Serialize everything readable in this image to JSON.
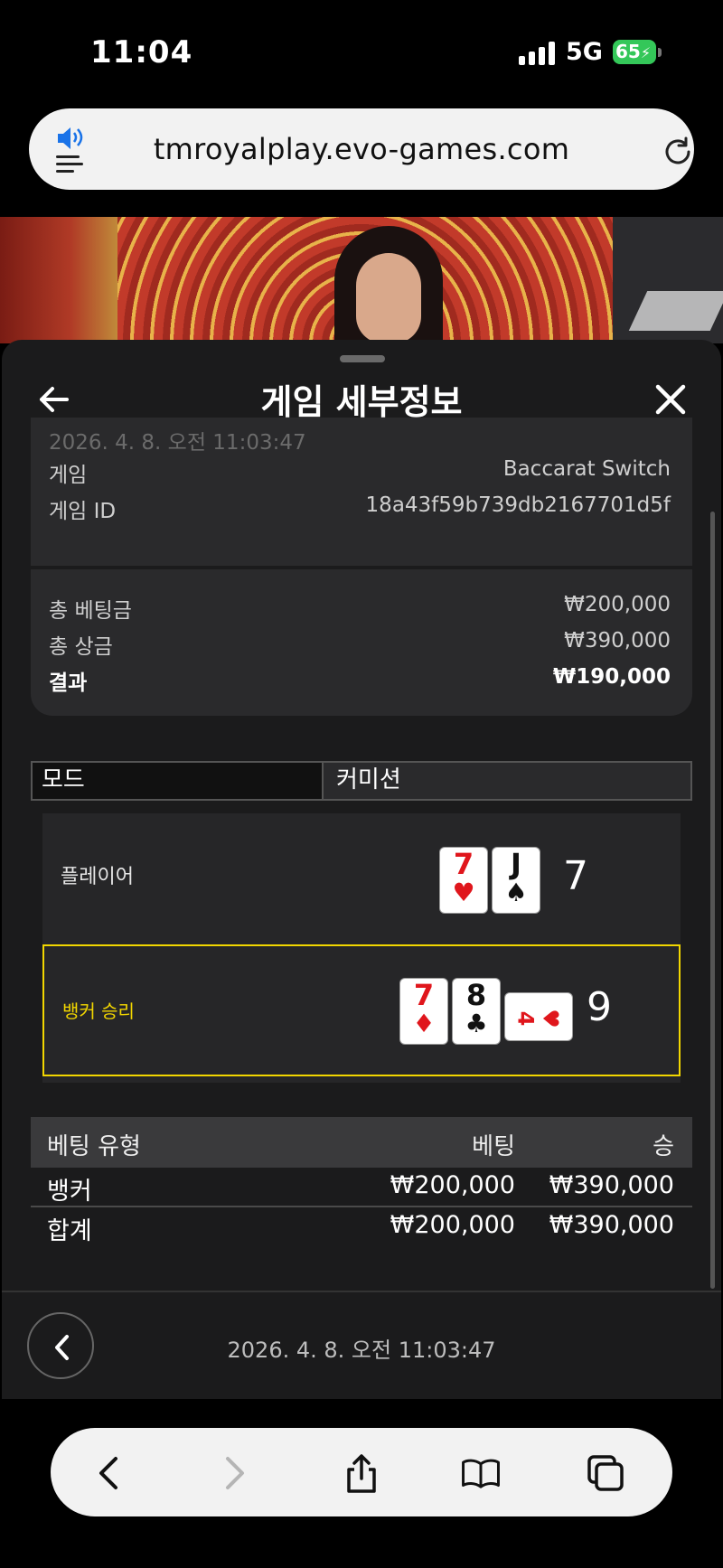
{
  "status": {
    "time": "11:04",
    "network": "5G",
    "battery": "65"
  },
  "browser": {
    "url": "tmroyalplay.evo-games.com"
  },
  "panel": {
    "title": "게임 세부정보",
    "info": {
      "date_faded": "2026. 4. 8. 오전 11:03:47",
      "game_label": "게임",
      "game_value": "Baccarat Switch",
      "game_id_label": "게임 ID",
      "game_id_value": "18a43f59b739db2167701d5f"
    },
    "summary": {
      "total_bet_label": "총 베팅금",
      "total_bet_value": "₩200,000",
      "total_win_label": "총 상금",
      "total_win_value": "₩390,000",
      "result_label": "결과",
      "result_value": "₩190,000"
    },
    "mode": {
      "label": "모드",
      "value": "커미션"
    },
    "result": {
      "player_label": "플레이어",
      "player_score": "7",
      "player_cards": [
        {
          "rank": "7",
          "suit": "♥",
          "color": "#e0161c"
        },
        {
          "rank": "J",
          "suit": "♠",
          "color": "#111111"
        }
      ],
      "banker_label": "뱅커 승리",
      "banker_score": "9",
      "banker_cards": [
        {
          "rank": "7",
          "suit": "♦",
          "color": "#e0161c"
        },
        {
          "rank": "8",
          "suit": "♣",
          "color": "#111111"
        },
        {
          "rank": "4",
          "suit": "♥",
          "color": "#e0161c"
        }
      ],
      "win_highlight_color": "#f2d600"
    },
    "bets": {
      "headers": {
        "type": "베팅 유형",
        "bet": "베팅",
        "win": "승"
      },
      "rows": [
        {
          "type": "뱅커",
          "bet": "₩200,000",
          "win": "₩390,000"
        },
        {
          "type": "합계",
          "bet": "₩200,000",
          "win": "₩390,000"
        }
      ]
    },
    "footer_date": "2026. 4. 8. 오전 11:03:47"
  }
}
